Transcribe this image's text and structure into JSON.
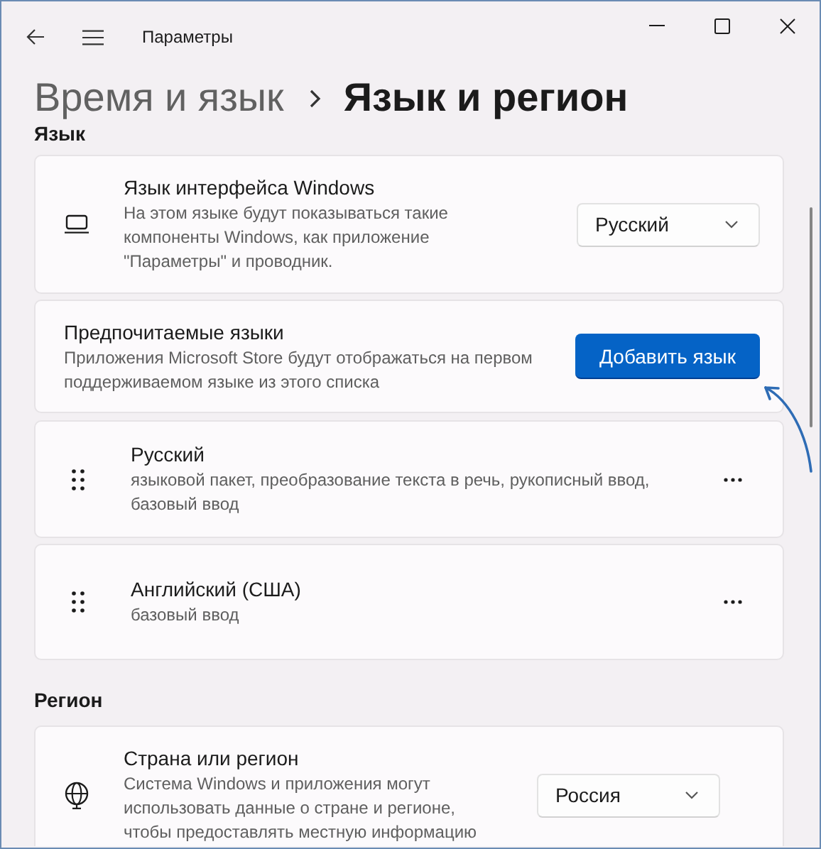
{
  "window": {
    "title": "Параметры"
  },
  "breadcrumb": [
    {
      "label": "Время и язык",
      "current": false
    },
    {
      "label": "Язык и регион",
      "current": true
    }
  ],
  "sections": [
    {
      "heading": "Язык",
      "cards": [
        {
          "kind": "dropdown",
          "title": "Язык интерфейса Windows",
          "description": "На этом языке будут показываться такие компоненты Windows, как приложение \"Параметры\" и проводник.",
          "value": "Русский"
        },
        {
          "kind": "button",
          "title": "Предпочитаемые языки",
          "description": "Приложения Microsoft Store будут отображаться на первом поддерживаемом языке из этого списка",
          "button": "Добавить язык"
        },
        {
          "kind": "language",
          "title": "Русский",
          "description": "языковой пакет, преобразование текста в речь, рукописный ввод, базовый ввод"
        },
        {
          "kind": "language",
          "title": "Английский (США)",
          "description": "базовый ввод"
        }
      ]
    },
    {
      "heading": "Регион",
      "cards": [
        {
          "kind": "dropdown",
          "title": "Страна или регион",
          "description": "Система Windows и приложения могут использовать данные о стране и регионе, чтобы предоставлять местную информацию",
          "value": "Россия"
        }
      ]
    }
  ]
}
